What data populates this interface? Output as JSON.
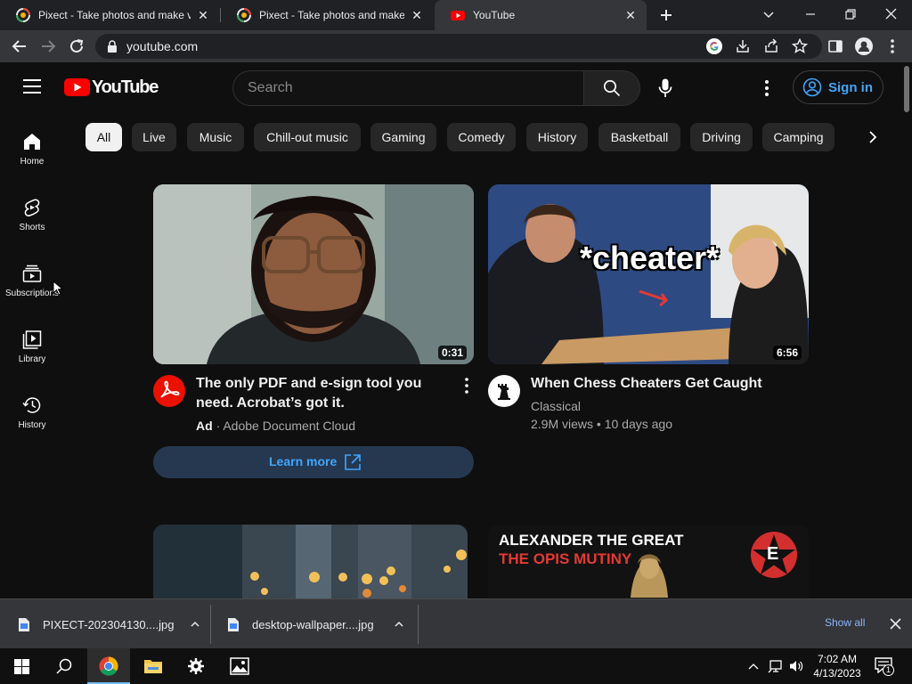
{
  "browser": {
    "tabs": [
      {
        "title": "Pixect - Take photos and make vi",
        "active": false
      },
      {
        "title": "Pixect - Take photos and make vi",
        "active": false
      },
      {
        "title": "YouTube",
        "active": true
      }
    ],
    "url": "youtube.com"
  },
  "youtube": {
    "logo_text": "YouTube",
    "search_placeholder": "Search",
    "signin_label": "Sign in",
    "chips": [
      "All",
      "Live",
      "Music",
      "Chill-out music",
      "Gaming",
      "Comedy",
      "History",
      "Basketball",
      "Driving",
      "Camping"
    ],
    "sidebar": [
      {
        "label": "Home",
        "icon": "home-icon"
      },
      {
        "label": "Shorts",
        "icon": "shorts-icon"
      },
      {
        "label": "Subscriptions",
        "icon": "subscriptions-icon"
      },
      {
        "label": "Library",
        "icon": "library-icon"
      },
      {
        "label": "History",
        "icon": "history-icon"
      }
    ],
    "videos": [
      {
        "title": "The only PDF and e-sign tool you need. Acrobat’s got it.",
        "ad_badge": "Ad",
        "channel": "Adobe Document Cloud",
        "duration": "0:31",
        "cta": "Learn more"
      },
      {
        "title": "When Chess Cheaters Get Caught",
        "channel": "Classical",
        "meta": "2.9M views • 10 days ago",
        "duration": "6:56",
        "thumb_text": "*cheater*"
      },
      {
        "thumb_text_1": "ALEXANDER THE GREAT",
        "thumb_text_2": "THE OPIS MUTINY",
        "thumb_logo": "E"
      }
    ]
  },
  "downloads": {
    "items": [
      "PIXECT-202304130....jpg",
      "desktop-wallpaper....jpg"
    ],
    "show_all": "Show all"
  },
  "taskbar": {
    "time": "7:02 AM",
    "date": "4/13/2023",
    "notification_count": "1"
  },
  "colors": {
    "yt_red": "#ff0000",
    "link_blue": "#3ea6ff",
    "adobe_red": "#eb1000",
    "chrome_bg": "#202124"
  }
}
